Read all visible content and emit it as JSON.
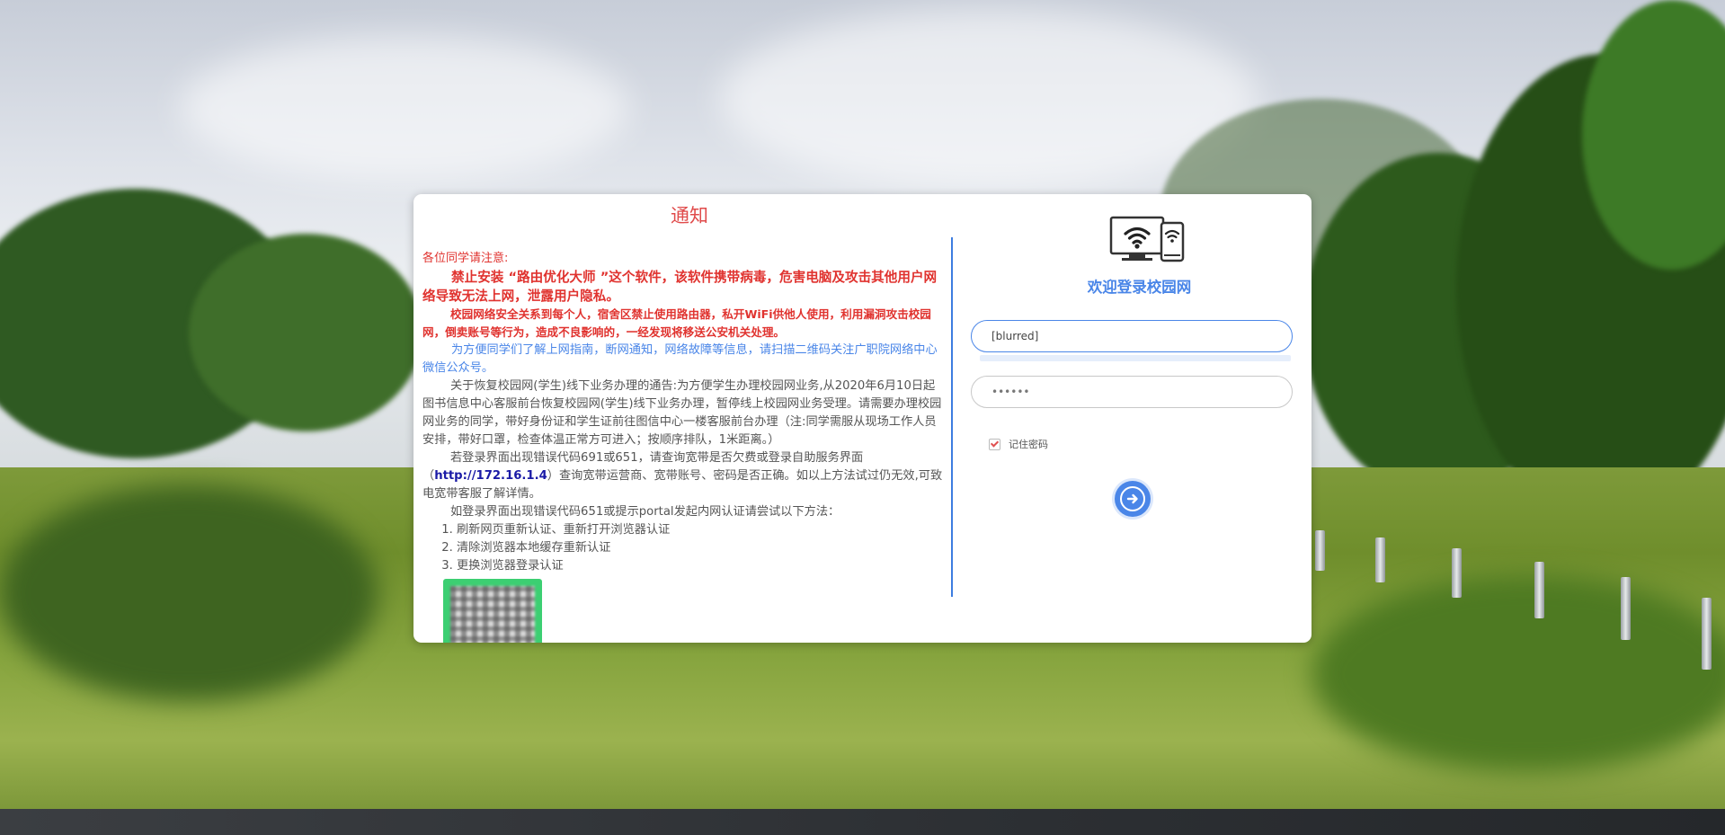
{
  "notice": {
    "title": "通知",
    "greeting": "各位同学请注意:",
    "warning_main": "禁止安装 “路由优化大师 ”这个软件，该软件携带病毒，危害电脑及攻击其他用户网络导致无法上网，泄露用户隐私。",
    "warning_security": "校园网络安全关系到每个人，宿舍区禁止使用路由器，私开WiFi供他人使用，利用漏洞攻击校园网，倒卖账号等行为，造成不良影响的，一经发现将移送公安机关处理。",
    "wechat_info": "为方便同学们了解上网指南，断网通知，网络故障等信息，请扫描二维码关注广职院网络中心微信公众号。",
    "resume_service": "关于恢复校园网(学生)线下业务办理的通告:为方便学生办理校园网业务,从2020年6月10日起图书信息中心客服前台恢复校园网(学生)线下业务办理，暂停线上校园网业务受理。请需要办理校园网业务的同学，带好身份证和学生证前往图信中心一楼客服前台办理（注:同学需服从现场工作人员安排，带好口罩，检查体温正常方可进入；按顺序排队，1米距离。）",
    "error_691_prefix": "若登录界面出现错误代码691或651，请查询宽带是否欠费或登录自助服务界面（",
    "error_691_link": "http://172.16.1.4",
    "error_691_suffix": "）查询宽带运营商、宽带账号、密码是否正确。如以上方法试过仍无效,可致电宽带客服了解详情。",
    "error_651_intro": "如登录界面出现错误代码651或提示portal发起内网认证请尝试以下方法：",
    "steps": [
      "刷新网页重新认证、重新打开浏览器认证",
      "清除浏览器本地缓存重新认证",
      "更换浏览器登录认证"
    ]
  },
  "login": {
    "welcome": "欢迎登录校园网",
    "username_value": "[blurred]",
    "password_value": "••••••",
    "remember_label": "记住密码",
    "remember_checked": true,
    "submit_icon": "arrow-right-circle-icon"
  },
  "colors": {
    "accent": "#4a86e8",
    "warning": "#e0332f",
    "title": "#e04b4b",
    "qr_border": "#3ccf72"
  }
}
